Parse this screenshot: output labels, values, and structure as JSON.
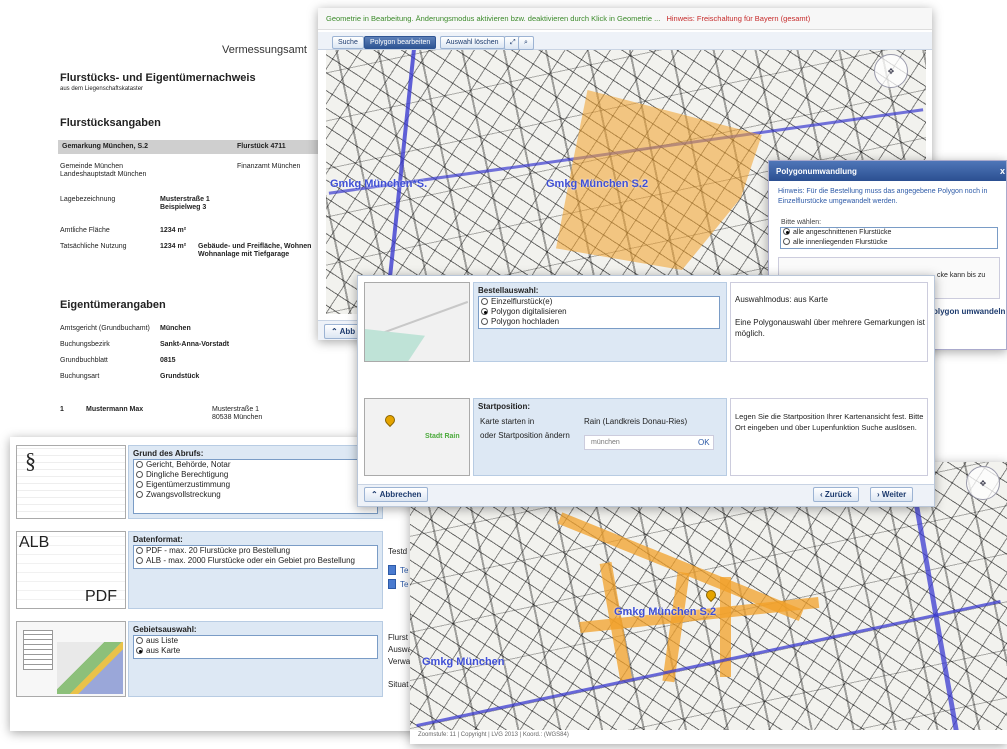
{
  "report": {
    "office": "Vermessungsamt",
    "title": "Flurstücks- und Eigentümernachweis",
    "subtitle": "aus dem Liegenschaftskataster",
    "section1": "Flurstücksangaben",
    "band_left": "Gemarkung München, S.2",
    "band_right": "Flurstück 4711",
    "gemeinde": "Gemeinde München",
    "landeshauptstadt": "Landeshauptstadt München",
    "finanzamt": "Finanzamt München",
    "lage_label": "Lagebezeichnung",
    "lage_value1": "Musterstraße 1",
    "lage_value2": "Beispielweg 3",
    "flaeche_label": "Amtliche Fläche",
    "flaeche_value": "1234 m²",
    "nutzung_label": "Tatsächliche Nutzung",
    "nutzung_value": "1234 m²",
    "nutzung_desc1": "Gebäude- und Freifläche, Wohnen",
    "nutzung_desc2": "Wohnanlage mit Tiefgarage",
    "section2": "Eigentümerangaben",
    "amtsgericht_label": "Amtsgericht (Grundbuchamt)",
    "amtsgericht_value": "München",
    "bezirk_label": "Buchungsbezirk",
    "bezirk_value": "Sankt-Anna-Vorstadt",
    "blatt_label": "Grundbuchblatt",
    "blatt_value": "0815",
    "art_label": "Buchungsart",
    "art_value": "Grundstück",
    "owner_no": "1",
    "owner_name": "Mustermann Max",
    "owner_addr1": "Musterstraße 1",
    "owner_addr2": "80538 München"
  },
  "mapwin": {
    "status_green": "Geometrie in Bearbeitung. Änderungsmodus aktivieren bzw. deaktivieren durch Klick in Geometrie ...",
    "status_red": "Hinweis: Freischaltung für Bayern (gesamt)",
    "btn_suche": "Suche",
    "btn_polygon": "Polygon bearbeiten",
    "btn_auswahl": "Auswahl löschen",
    "label1": "Gmkg München*S.",
    "label2": "Gmkg München S.2",
    "abbr": "Abb"
  },
  "polydlg": {
    "title": "Polygonumwandlung",
    "close": "x",
    "hint": "Hinweis: Für die Bestellung muss das angegebene Polygon noch in Einzelflurstücke umgewandelt werden.",
    "choose": "Bitte wählen:",
    "opt1": "alle angeschnittenen Flurstücke",
    "opt2": "alle innenliegenden Flurstücke",
    "partial": "cke kann bis zu",
    "btn": "olygon umwandeln"
  },
  "mainwin": {
    "bestell_title": "Bestellauswahl:",
    "bestell_opts": [
      "Einzelflurstück(e)",
      "Polygon digitalisieren",
      "Polygon hochladen"
    ],
    "mode_text": "Auswahlmodus: aus Karte",
    "mode_desc": "Eine Polygonauswahl über mehrere Gemarkungen ist möglich.",
    "start_title": "Startposition:",
    "start_l1": "Karte starten in",
    "start_l2": "oder Startposition ändern",
    "start_place": "Rain (Landkreis Donau-Ries)",
    "start_input": "münchen",
    "start_ok": "OK",
    "start_desc": "Legen Sie die Startposition Ihrer Kartenansicht fest. Bitte Ort eingeben und über Lupenfunktion Suche auslösen.",
    "thumb_label": "Stadt Rain",
    "btn_abbrechen": "Abbrechen",
    "btn_zurueck": "Zurück",
    "btn_weiter": "Weiter"
  },
  "formwin": {
    "grund_title": "Grund des Abrufs:",
    "grund_opts": [
      "Gericht, Behörde, Notar",
      "Dingliche Berechtigung",
      "Eigentümerzustimmung",
      "Zwangsvollstreckung"
    ],
    "daten_title": "Datenformat:",
    "daten_opts": [
      "PDF - max. 20 Flurstücke pro Bestellung",
      "ALB - max. 2000 Flurstücke oder ein Gebiet pro Bestellung"
    ],
    "gebiet_title": "Gebietsauswahl:",
    "gebiet_opts": [
      "aus Liste",
      "aus Karte"
    ],
    "side_testd": "Testd",
    "side_te1": "Te",
    "side_te2": "Te",
    "side_flurst": "Flurst",
    "side_ausw": "Auswa",
    "side_verw": "Verwa",
    "side_situat": "Situat",
    "thumb_sect": "§",
    "thumb_alb": "ALB",
    "thumb_pdf": "PDF"
  },
  "bottommap": {
    "label1": "Gmkg München",
    "label2": "Gmkg München S.2",
    "footer": "Zoomstufe: 11 | Copyright | LVG 2013 | Koord.: (WGS84)"
  }
}
